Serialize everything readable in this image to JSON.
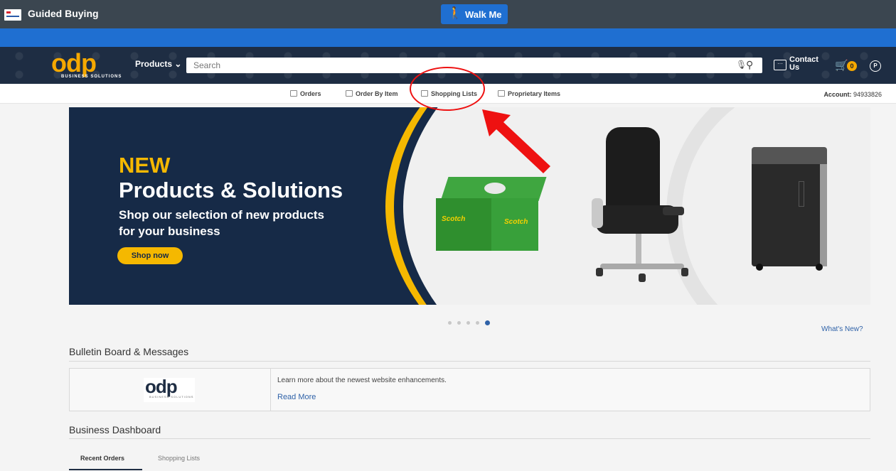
{
  "top_bar": {
    "title": "Guided Buying",
    "walkme_label": "Walk Me"
  },
  "header": {
    "logo_text": "odp",
    "logo_subtext": "BUSINESS SOLUTIONS",
    "products_label": "Products",
    "search_placeholder": "Search",
    "contact_label": "Contact Us",
    "cart_count": "0",
    "profile_initial": "P"
  },
  "sub_nav": {
    "items": [
      {
        "label": "Orders",
        "icon": "orders-icon"
      },
      {
        "label": "Order By Item",
        "icon": "order-by-item-icon"
      },
      {
        "label": "Shopping Lists",
        "icon": "shopping-lists-icon"
      },
      {
        "label": "Proprietary Items",
        "icon": "proprietary-items-icon"
      }
    ],
    "account_label": "Account:",
    "account_number": "94933826"
  },
  "hero": {
    "kicker": "NEW",
    "title": "Products & Solutions",
    "subtitle": "Shop our selection of new products for your business",
    "cta": "Shop now",
    "tape_brand": "Scotch",
    "carousel_total": 5,
    "carousel_active": 5
  },
  "whats_new": "What's New?",
  "bulletin": {
    "title": "Bulletin Board & Messages",
    "logo_text": "odp",
    "message": "Learn more about the newest website enhancements.",
    "link": "Read More"
  },
  "dashboard": {
    "title": "Business Dashboard",
    "tabs": [
      {
        "label": "Recent Orders",
        "active": true
      },
      {
        "label": "Shopping Lists",
        "active": false
      }
    ]
  },
  "colors": {
    "nav_dark": "#1e2d43",
    "accent_blue": "#1f6fd1",
    "brand_yellow": "#f5b800",
    "annotation_red": "#e11"
  }
}
